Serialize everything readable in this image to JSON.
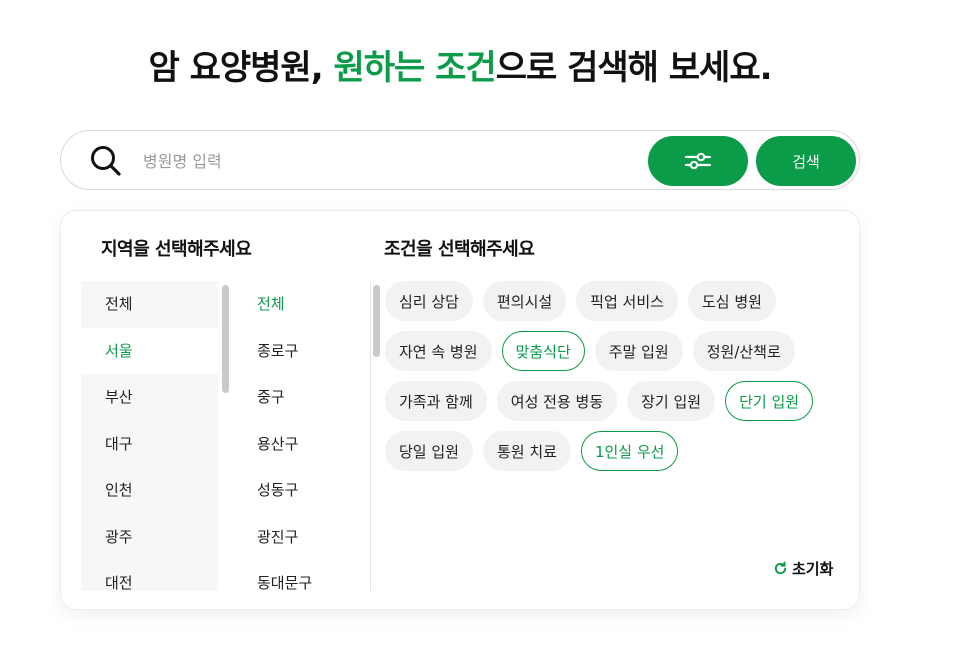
{
  "headline": {
    "part1": "암 요양병원, ",
    "accent": "원하는 조건",
    "part2": "으로 검색해 보세요."
  },
  "search": {
    "placeholder": "병원명 입력",
    "value": "",
    "search_label": "검색"
  },
  "colors": {
    "accent": "#0a9c48",
    "chip_bg": "#f2f2f2"
  },
  "region": {
    "title": "지역을 선택해주세요",
    "items": [
      "전체",
      "서울",
      "부산",
      "대구",
      "인천",
      "광주",
      "대전"
    ],
    "selected": "서울"
  },
  "subregion": {
    "items": [
      "전체",
      "종로구",
      "중구",
      "용산구",
      "성동구",
      "광진구",
      "동대문구"
    ],
    "selected": "전체"
  },
  "conditions": {
    "title": "조건을 선택해주세요",
    "chips": [
      {
        "label": "심리 상담",
        "selected": false
      },
      {
        "label": "편의시설",
        "selected": false
      },
      {
        "label": "픽업 서비스",
        "selected": false
      },
      {
        "label": "도심 병원",
        "selected": false
      },
      {
        "label": "자연 속 병원",
        "selected": false
      },
      {
        "label": "맞춤식단",
        "selected": true
      },
      {
        "label": "주말 입원",
        "selected": false
      },
      {
        "label": "정원/산책로",
        "selected": false
      },
      {
        "label": "가족과 함께",
        "selected": false
      },
      {
        "label": "여성 전용 병동",
        "selected": false
      },
      {
        "label": "장기 입원",
        "selected": false
      },
      {
        "label": "단기 입원",
        "selected": true
      },
      {
        "label": "당일 입원",
        "selected": false
      },
      {
        "label": "통원 치료",
        "selected": false
      },
      {
        "label": "1인실 우선",
        "selected": true
      }
    ],
    "reset_label": "초기화",
    "reset_icon": "refresh-icon"
  }
}
